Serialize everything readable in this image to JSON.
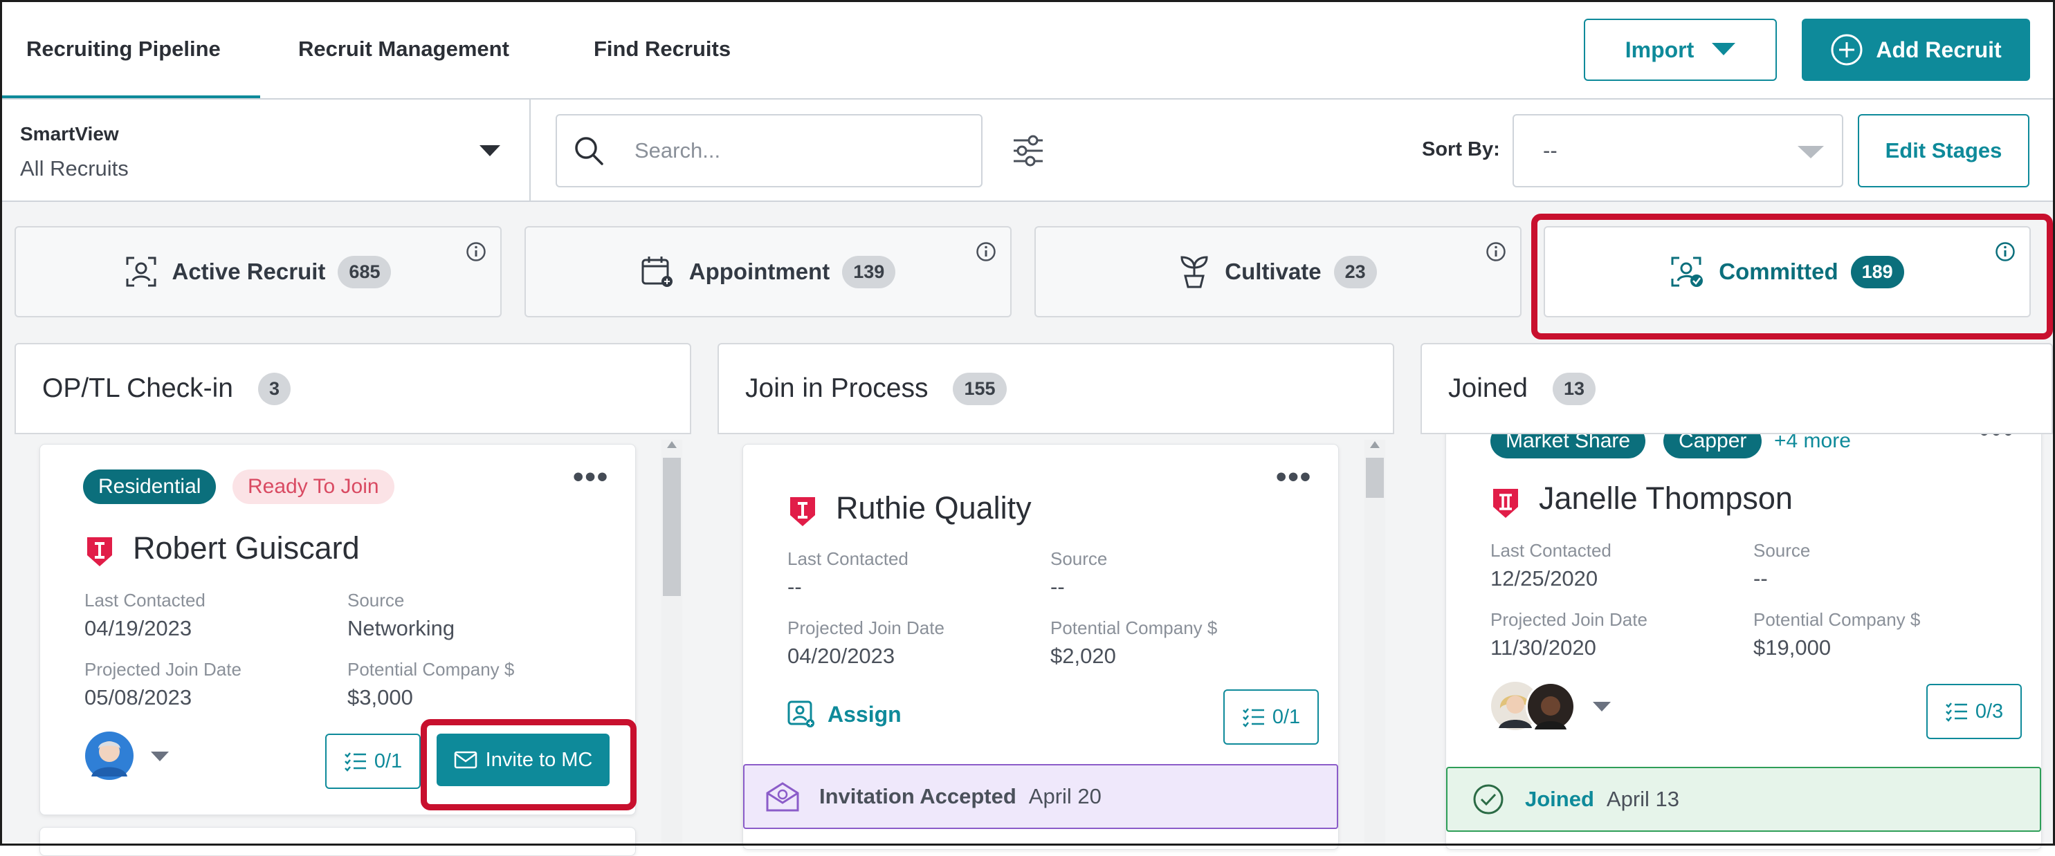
{
  "nav": {
    "tabs": [
      "Recruiting Pipeline",
      "Recruit Management",
      "Find Recruits"
    ],
    "import_label": "Import",
    "add_recruit_label": "Add Recruit"
  },
  "toolbar": {
    "smartview_label": "SmartView",
    "smartview_value": "All Recruits",
    "search_placeholder": "Search...",
    "sort_by_label": "Sort By:",
    "sort_by_value": "--",
    "edit_stages_label": "Edit Stages"
  },
  "stages": [
    {
      "label": "Active Recruit",
      "count": "685"
    },
    {
      "label": "Appointment",
      "count": "139"
    },
    {
      "label": "Cultivate",
      "count": "23"
    },
    {
      "label": "Committed",
      "count": "189"
    }
  ],
  "columns": [
    {
      "title": "OP/TL Check-in",
      "count": "3",
      "card": {
        "chips": [
          "Residential",
          "Ready To Join"
        ],
        "name": "Robert Guiscard",
        "last_contacted_label": "Last Contacted",
        "last_contacted": "04/19/2023",
        "source_label": "Source",
        "source": "Networking",
        "projected_label": "Projected Join Date",
        "projected": "05/08/2023",
        "potential_label": "Potential Company $",
        "potential": "$3,000",
        "tasks": "0/1",
        "invite_label": "Invite to MC"
      }
    },
    {
      "title": "Join in Process",
      "count": "155",
      "card": {
        "name": "Ruthie Quality",
        "last_contacted_label": "Last Contacted",
        "last_contacted": "--",
        "source_label": "Source",
        "source": "--",
        "projected_label": "Projected Join Date",
        "projected": "04/20/2023",
        "potential_label": "Potential Company $",
        "potential": "$2,020",
        "assign_label": "Assign",
        "tasks": "0/1",
        "status_label": "Invitation Accepted",
        "status_date": "April 20"
      }
    },
    {
      "title": "Joined",
      "count": "13",
      "card": {
        "chips": [
          "Market Share",
          "Capper"
        ],
        "more_label": "+4 more",
        "name": "Janelle Thompson",
        "last_contacted_label": "Last Contacted",
        "last_contacted": "12/25/2020",
        "source_label": "Source",
        "source": "--",
        "projected_label": "Projected Join Date",
        "projected": "11/30/2020",
        "potential_label": "Potential Company $",
        "potential": "$19,000",
        "tasks": "0/3",
        "status_label": "Joined",
        "status_date": "April 13"
      }
    }
  ],
  "colors": {
    "accent": "#0e8a9a",
    "accent_dark": "#0b6f7c",
    "highlight": "#c8102e",
    "brand_red": "#e11d48",
    "purple": "#8b5cc9",
    "green": "#2e9e58"
  }
}
